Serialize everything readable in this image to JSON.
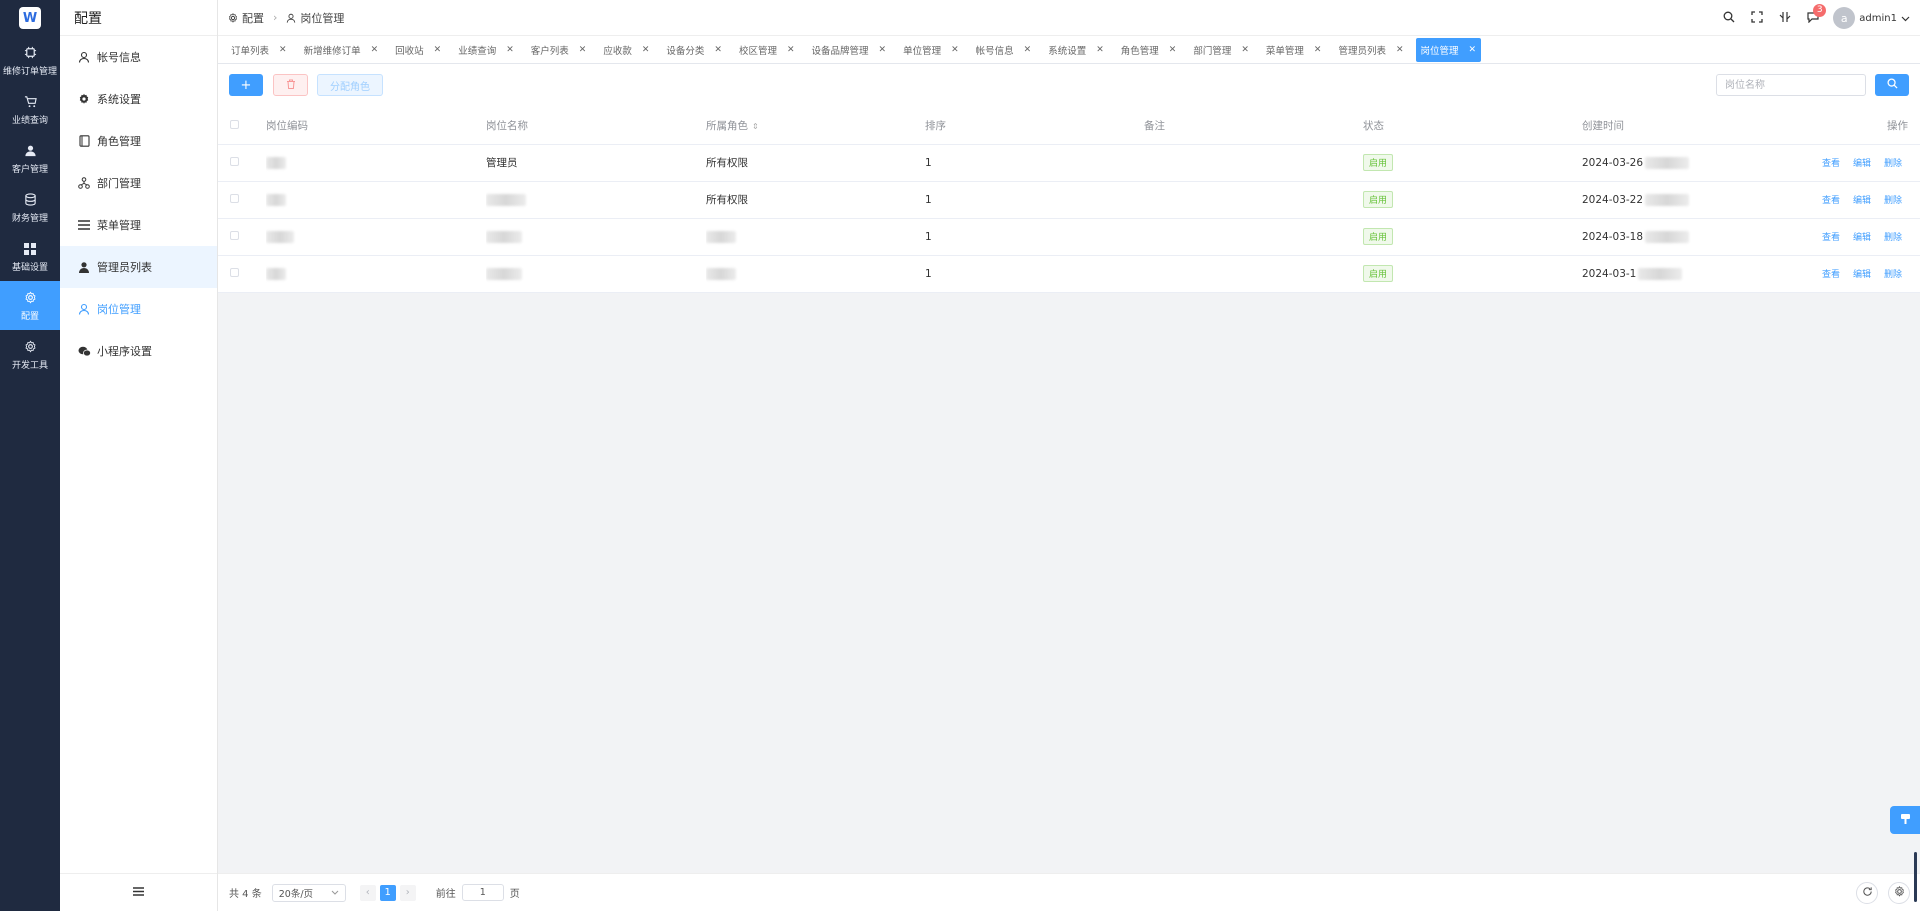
{
  "app": {
    "logo_text": "W"
  },
  "rail": [
    {
      "label": "维修订单管理",
      "icon": "chip-icon"
    },
    {
      "label": "业绩查询",
      "icon": "cart-icon"
    },
    {
      "label": "客户管理",
      "icon": "person-icon"
    },
    {
      "label": "财务管理",
      "icon": "database-icon"
    },
    {
      "label": "基础设置",
      "icon": "grid-icon"
    },
    {
      "label": "配置",
      "icon": "gear-icon",
      "active": true
    },
    {
      "label": "开发工具",
      "icon": "gear-icon"
    }
  ],
  "submenu": {
    "title": "配置",
    "items": [
      {
        "label": "帐号信息",
        "icon": "user-outline-icon"
      },
      {
        "label": "系统设置",
        "icon": "gear-icon"
      },
      {
        "label": "角色管理",
        "icon": "book-icon"
      },
      {
        "label": "部门管理",
        "icon": "org-icon"
      },
      {
        "label": "菜单管理",
        "icon": "list-icon"
      },
      {
        "label": "管理员列表",
        "icon": "person-icon",
        "highlighted": true
      },
      {
        "label": "岗位管理",
        "icon": "user-outline-icon",
        "active": true
      },
      {
        "label": "小程序设置",
        "icon": "wechat-icon"
      }
    ],
    "collapse_icon": "hamburger-icon"
  },
  "breadcrumb": {
    "root": "配置",
    "current": "岗位管理"
  },
  "header": {
    "notification_count": "3",
    "user_initial": "a",
    "username": "admin1"
  },
  "tabs": [
    "订单列表",
    "新增维修订单",
    "回收站",
    "业绩查询",
    "客户列表",
    "应收款",
    "设备分类",
    "校区管理",
    "设备品牌管理",
    "单位管理",
    "帐号信息",
    "系统设置",
    "角色管理",
    "部门管理",
    "菜单管理",
    "管理员列表",
    "岗位管理"
  ],
  "toolbar": {
    "add_label": "+",
    "assign_label": "分配角色",
    "search_placeholder": "岗位名称"
  },
  "table": {
    "columns": [
      "岗位编码",
      "岗位名称",
      "所属角色",
      "排序",
      "备注",
      "状态",
      "创建时间",
      "操作"
    ],
    "rows": [
      {
        "name": "管理员",
        "role": "所有权限",
        "sort": "1",
        "status": "启用",
        "created": "2024-03-26"
      },
      {
        "name": "",
        "role": "所有权限",
        "sort": "1",
        "status": "启用",
        "created": "2024-03-22"
      },
      {
        "name": "",
        "role": "",
        "sort": "1",
        "status": "启用",
        "created": "2024-03-18"
      },
      {
        "name": "",
        "role": "",
        "sort": "1",
        "status": "启用",
        "created": "2024-03-1"
      }
    ],
    "actions": {
      "view": "查看",
      "edit": "编辑",
      "delete": "删除"
    }
  },
  "pagination": {
    "total": "共 4 条",
    "page_size": "20条/页",
    "current_page": "1",
    "goto_label": "前往",
    "goto_value": "1",
    "page_suffix": "页"
  },
  "colors": {
    "primary": "#409eff",
    "rail_bg": "#1f2a40",
    "success": "#67c23a",
    "danger": "#f56c6c"
  }
}
